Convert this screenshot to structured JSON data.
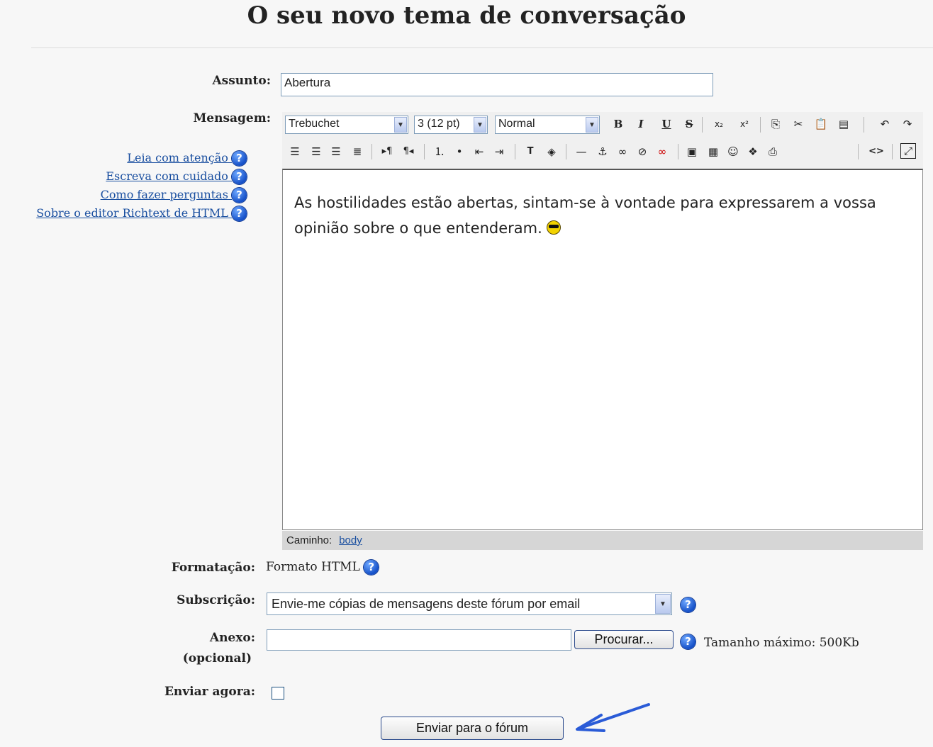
{
  "page": {
    "title": "O seu novo tema de conversação"
  },
  "form": {
    "subject_label": "Assunto:",
    "subject_value": "Abertura",
    "message_label": "Mensagem:",
    "help_links": [
      "Leia com atenção",
      "Escreva com cuidado",
      "Como fazer perguntas",
      "Sobre o editor Richtext de HTML"
    ],
    "format_label": "Formatação:",
    "format_value": "Formato HTML",
    "subscription_label": "Subscrição:",
    "subscription_value": "Envie-me cópias de mensagens deste fórum por email",
    "attachment_label": "Anexo:",
    "attachment_optional": "(opcional)",
    "attachment_value": "",
    "browse_button": "Procurar...",
    "max_size": "Tamanho máximo: 500Kb",
    "send_now_label": "Enviar agora:",
    "send_now_checked": false,
    "submit_button": "Enviar para o fórum"
  },
  "editor": {
    "font": "Trebuchet",
    "size": "3 (12 pt)",
    "paragraph": "Normal",
    "content": "As hostilidades estão abertas, sintam-se à vontade para expressarem a vossa opinião sobre o que entenderam.",
    "path_label": "Caminho:",
    "path_value": "body"
  },
  "icons": {
    "help": "?",
    "dropdown": "▼",
    "bold": "B",
    "italic": "I",
    "underline": "U",
    "strike": "S",
    "subscript": "x₂",
    "superscript": "x²",
    "undo": "↶",
    "redo": "↷",
    "html_source": "<>",
    "fullscreen": "⤢"
  },
  "colors": {
    "link": "#1a4fa0",
    "help_icon": "#1550c8",
    "arrow": "#2a5bd7"
  }
}
